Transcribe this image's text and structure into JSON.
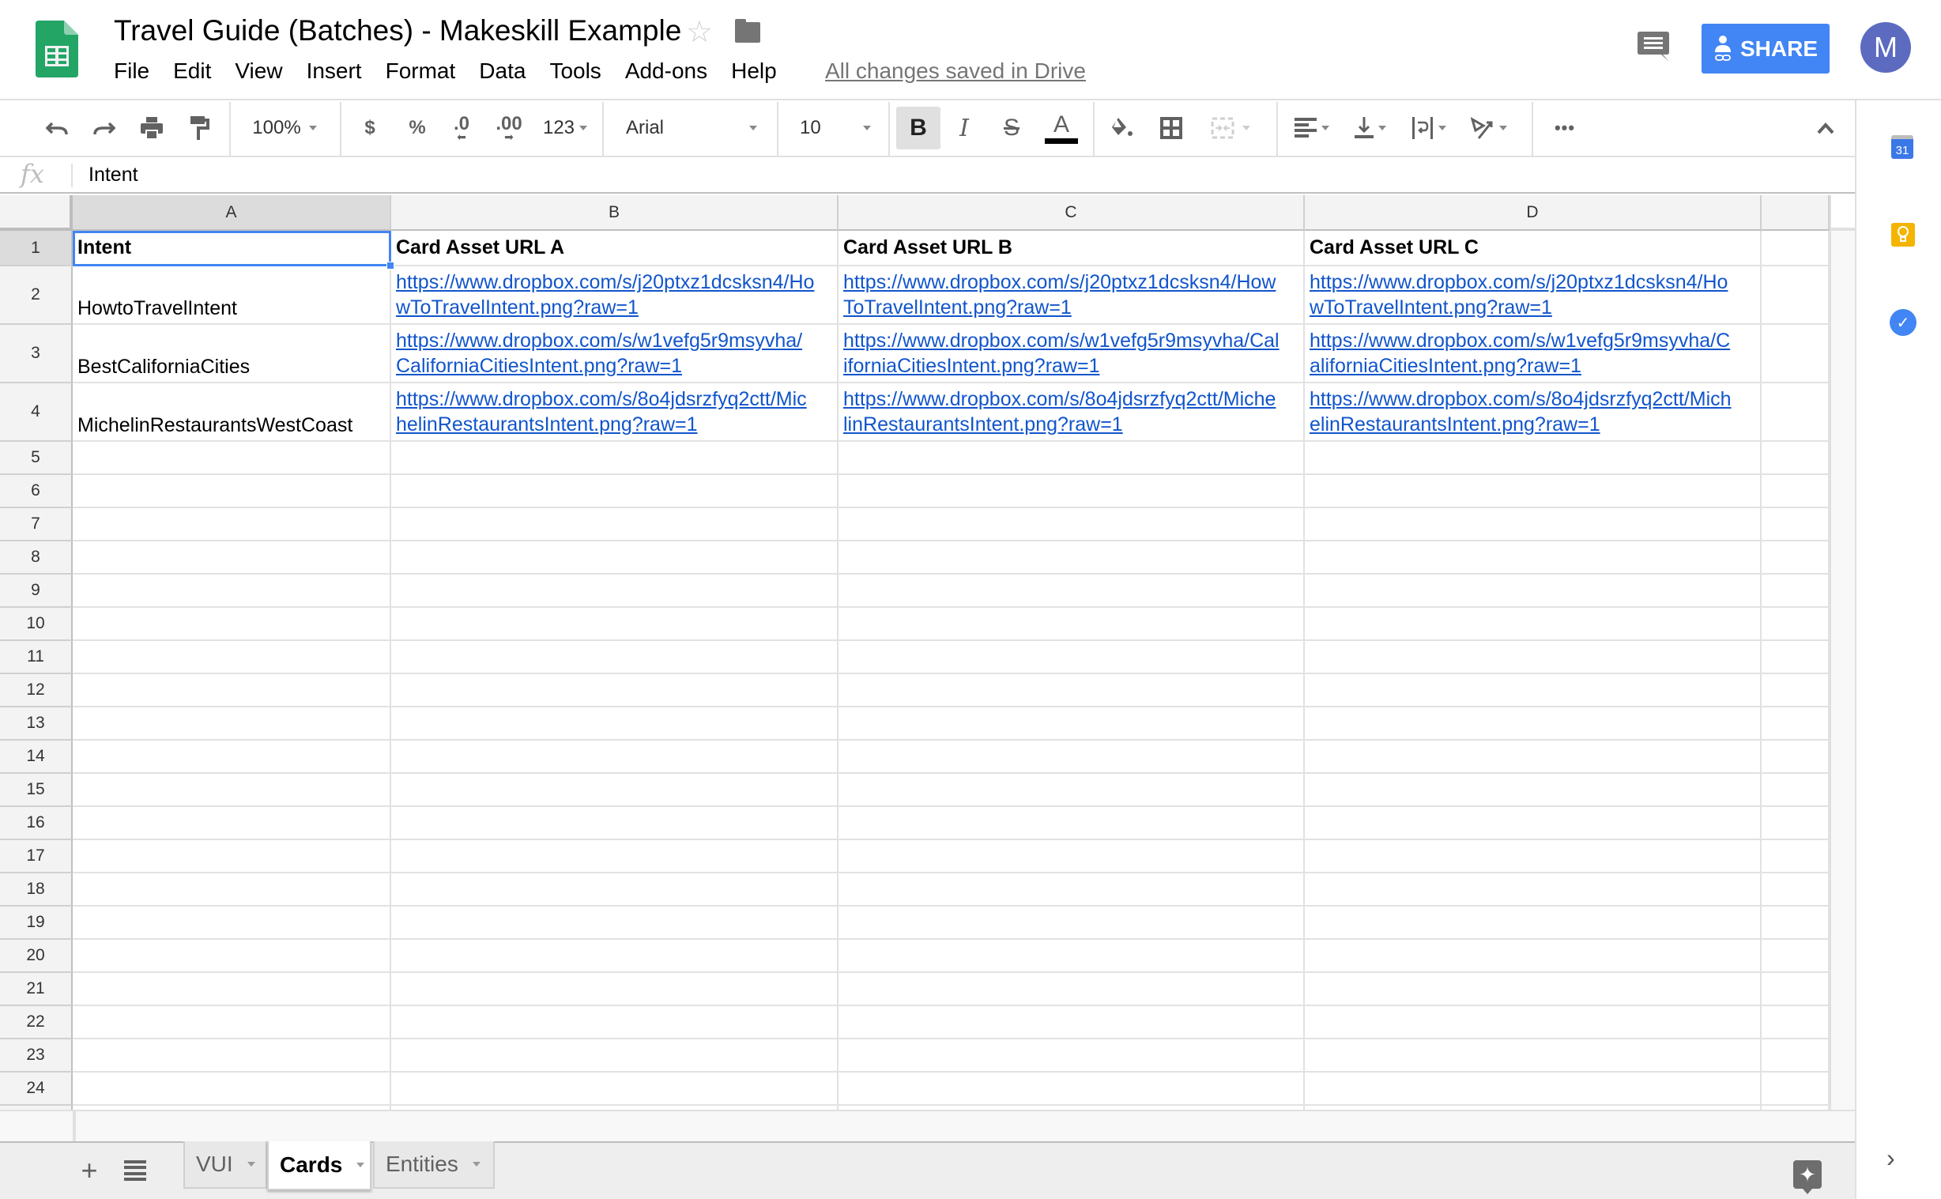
{
  "app": {
    "title": "Travel Guide (Batches) - Makeskill Example",
    "star_icon": "☆",
    "menu": [
      "File",
      "Edit",
      "View",
      "Insert",
      "Format",
      "Data",
      "Tools",
      "Add-ons",
      "Help"
    ],
    "save_status": "All changes saved in Drive",
    "share_label": "SHARE",
    "avatar_initial": "M",
    "colors": {
      "share": "#4285f4",
      "avatar": "#5c6bc0",
      "link": "#1155cc",
      "selection": "#4285f4",
      "sheets_green": "#23a566"
    }
  },
  "toolbar": {
    "undo": "↶",
    "redo": "↷",
    "zoom": "100%",
    "currency": "$",
    "percent": "%",
    "decrease_decimals": ".0",
    "increase_decimals": ".00",
    "more_formats": "123",
    "font": "Arial",
    "font_size": "10",
    "bold": "B",
    "italic": "I",
    "strikethrough": "S",
    "text_color": "A",
    "more": "•••",
    "collapse": "⌃"
  },
  "formula_bar": {
    "fx": "fx",
    "value": "Intent"
  },
  "grid": {
    "columns": [
      "A",
      "B",
      "C",
      "D",
      ""
    ],
    "selected_cell": "A1",
    "row_numbers": [
      "1",
      "2",
      "3",
      "4",
      "5",
      "6",
      "7",
      "8",
      "9",
      "10",
      "11",
      "12",
      "13",
      "14",
      "15",
      "16",
      "17",
      "18",
      "19",
      "20",
      "21",
      "22",
      "23",
      "24"
    ],
    "header_row": [
      "Intent",
      "Card Asset URL A",
      "Card Asset URL B",
      "Card Asset URL C"
    ],
    "rows": [
      {
        "intent": "HowtoTravelIntent",
        "urls": [
          [
            "https://www.dropbox.com/s/j20ptxz1dcsksn4/Ho",
            "wToTravelIntent.png?raw=1"
          ],
          [
            "https://www.dropbox.com/s/j20ptxz1dcsksn4/How",
            "ToTravelIntent.png?raw=1"
          ],
          [
            "https://www.dropbox.com/s/j20ptxz1dcsksn4/Ho",
            "wToTravelIntent.png?raw=1"
          ]
        ]
      },
      {
        "intent": "BestCaliforniaCities",
        "urls": [
          [
            "https://www.dropbox.com/s/w1vefg5r9msyvha/",
            "CaliforniaCitiesIntent.png?raw=1"
          ],
          [
            "https://www.dropbox.com/s/w1vefg5r9msyvha/Cal",
            "iforniaCitiesIntent.png?raw=1"
          ],
          [
            "https://www.dropbox.com/s/w1vefg5r9msyvha/C",
            "aliforniaCitiesIntent.png?raw=1"
          ]
        ]
      },
      {
        "intent": "MichelinRestaurantsWestCoast",
        "urls": [
          [
            "https://www.dropbox.com/s/8o4jdsrzfyq2ctt/Mic",
            "helinRestaurantsIntent.png?raw=1"
          ],
          [
            "https://www.dropbox.com/s/8o4jdsrzfyq2ctt/Miche",
            "linRestaurantsIntent.png?raw=1"
          ],
          [
            "https://www.dropbox.com/s/8o4jdsrzfyq2ctt/Mich",
            "elinRestaurantsIntent.png?raw=1"
          ]
        ]
      }
    ]
  },
  "sheets": {
    "add": "+",
    "tabs": [
      {
        "label": "VUI",
        "active": false
      },
      {
        "label": "Cards",
        "active": true
      },
      {
        "label": "Entities",
        "active": false
      }
    ]
  },
  "side_panel": {
    "calendar_label": "31",
    "keep_glyph": "💡",
    "tasks_glyph": "✓",
    "expand": "›"
  },
  "explore_glyph": "✦"
}
